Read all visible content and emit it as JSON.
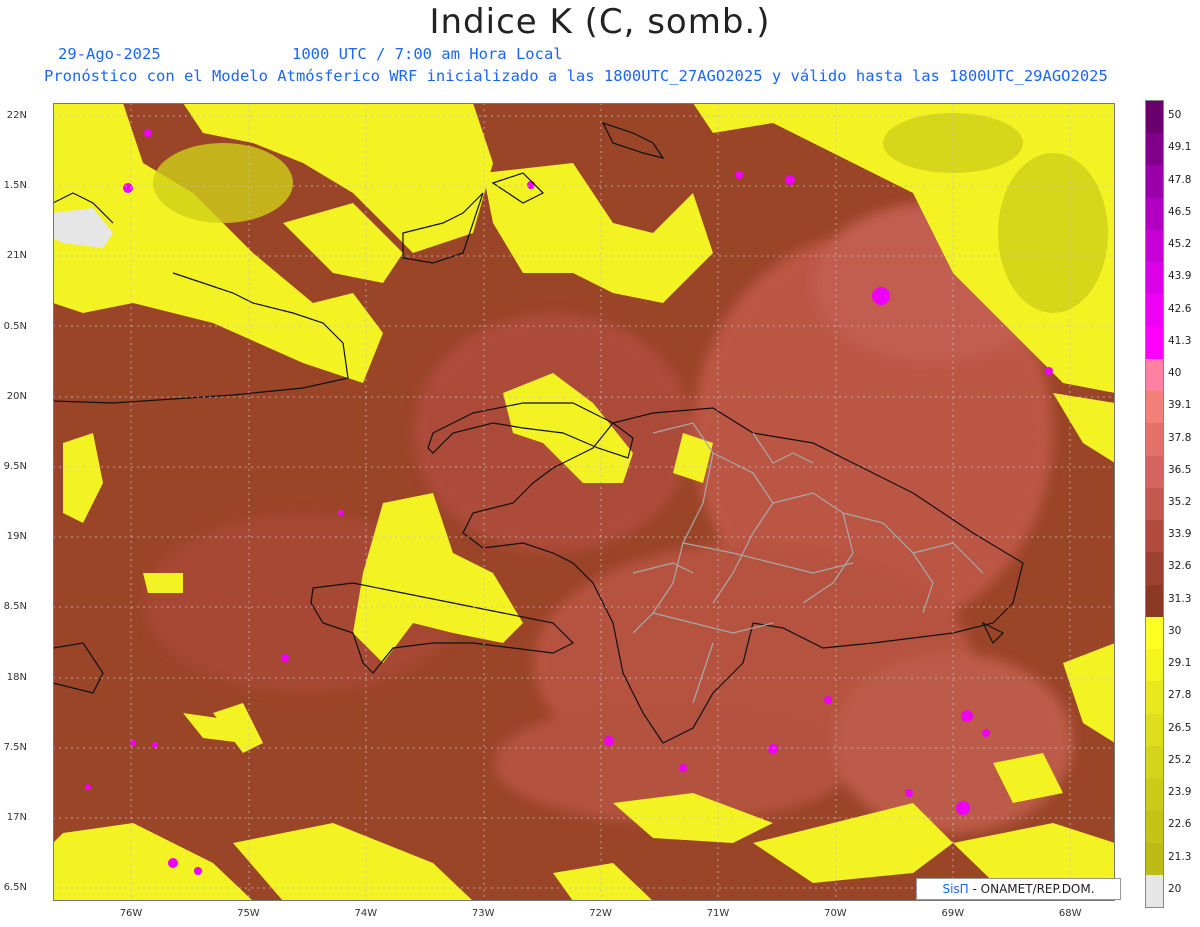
{
  "title": "Indice K (C, somb.)",
  "date": "29-Ago-2025",
  "time": "1000 UTC / 7:00 am Hora Local",
  "model_line": "Pronóstico con el Modelo Atmósferico WRF inicializado a las 1800UTC_27AGO2025 y válido hasta las  1800UTC_29AGO2025",
  "y_labels": [
    "22N",
    "1.5N",
    "21N",
    "0.5N",
    "20N",
    "9.5N",
    "19N",
    "8.5N",
    "18N",
    "7.5N",
    "17N",
    "6.5N"
  ],
  "x_labels": [
    "76W",
    "75W",
    "74W",
    "73W",
    "72W",
    "71W",
    "70W",
    "69W",
    "68W"
  ],
  "legend": {
    "labels": [
      "50",
      "49.1",
      "47.8",
      "46.5",
      "45.2",
      "43.9",
      "42.6",
      "41.3",
      "40",
      "39.1",
      "37.8",
      "36.5",
      "35.2",
      "33.9",
      "32.6",
      "31.3",
      "30",
      "29.1",
      "27.8",
      "26.5",
      "25.2",
      "23.9",
      "22.6",
      "21.3",
      "20"
    ],
    "colors": [
      "#6a006e",
      "#80008a",
      "#9a00a8",
      "#b200c2",
      "#c800d8",
      "#dc00ea",
      "#ee00f6",
      "#ff00ff",
      "#ff80a0",
      "#f08078",
      "#e27268",
      "#d46560",
      "#c45a4e",
      "#b04c3c",
      "#9c4230",
      "#8a3a22",
      "#ffff24",
      "#f4f41e",
      "#e8e81c",
      "#dede1c",
      "#d4d41a",
      "#cccc18",
      "#c4c416",
      "#bcbc14",
      "#e6e6e6"
    ]
  },
  "credit": {
    "brand": "SisΠ",
    "text": " - ONAMET/REP.DOM."
  }
}
